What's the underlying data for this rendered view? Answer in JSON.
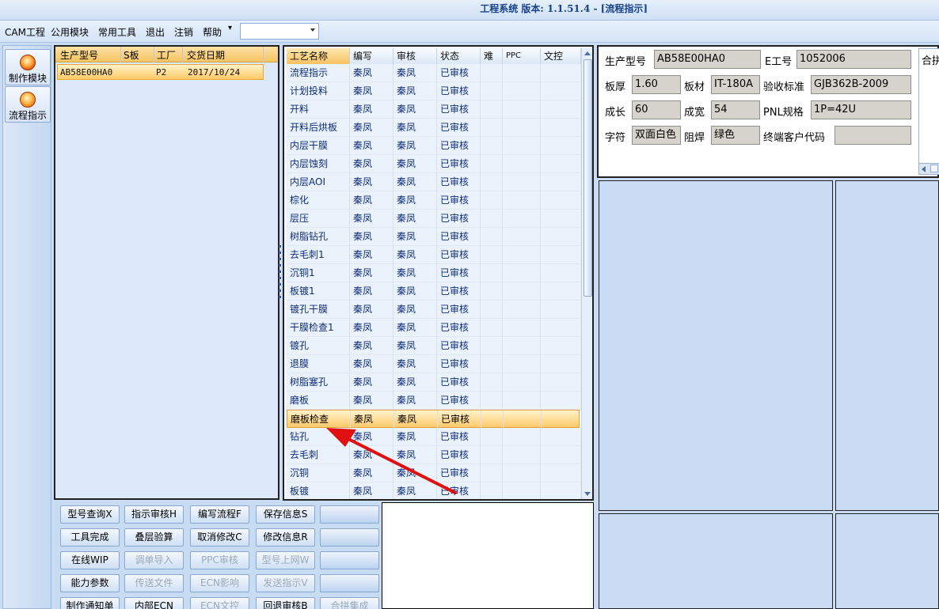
{
  "window": {
    "title": "工程系统  版本: 1.1.51.4 - [流程指示]"
  },
  "menu": {
    "items": [
      "CAM工程",
      "公用模块",
      "常用工具",
      "退出",
      "注销",
      "帮助"
    ],
    "combo_value": ""
  },
  "nav": {
    "make_module": "制作模块",
    "flow_guide": "流程指示"
  },
  "prod_table": {
    "headers": [
      "生产型号",
      "S板",
      "工厂",
      "交货日期"
    ],
    "row": {
      "model": "AB58E00HA0",
      "s_board": "",
      "factory": "P2",
      "date": "2017/10/24"
    }
  },
  "proc_table": {
    "headers": [
      "工艺名称",
      "编写",
      "审核",
      "状态",
      "难",
      "PPC",
      "文控"
    ],
    "rows": [
      {
        "name": "流程指示",
        "writer": "秦凤",
        "reviewer": "秦凤",
        "status": "已审核"
      },
      {
        "name": "计划投料",
        "writer": "秦凤",
        "reviewer": "秦凤",
        "status": "已审核"
      },
      {
        "name": "开料",
        "writer": "秦凤",
        "reviewer": "秦凤",
        "status": "已审核"
      },
      {
        "name": "开料后烘板",
        "writer": "秦凤",
        "reviewer": "秦凤",
        "status": "已审核"
      },
      {
        "name": "内层干膜",
        "writer": "秦凤",
        "reviewer": "秦凤",
        "status": "已审核"
      },
      {
        "name": "内层蚀刻",
        "writer": "秦凤",
        "reviewer": "秦凤",
        "status": "已审核"
      },
      {
        "name": "内层AOI",
        "writer": "秦凤",
        "reviewer": "秦凤",
        "status": "已审核"
      },
      {
        "name": "棕化",
        "writer": "秦凤",
        "reviewer": "秦凤",
        "status": "已审核"
      },
      {
        "name": "层压",
        "writer": "秦凤",
        "reviewer": "秦凤",
        "status": "已审核"
      },
      {
        "name": "树脂钻孔",
        "writer": "秦凤",
        "reviewer": "秦凤",
        "status": "已审核"
      },
      {
        "name": "去毛刺1",
        "writer": "秦凤",
        "reviewer": "秦凤",
        "status": "已审核"
      },
      {
        "name": "沉铜1",
        "writer": "秦凤",
        "reviewer": "秦凤",
        "status": "已审核"
      },
      {
        "name": "板镀1",
        "writer": "秦凤",
        "reviewer": "秦凤",
        "status": "已审核"
      },
      {
        "name": "镀孔干膜",
        "writer": "秦凤",
        "reviewer": "秦凤",
        "status": "已审核"
      },
      {
        "name": "干膜检查1",
        "writer": "秦凤",
        "reviewer": "秦凤",
        "status": "已审核"
      },
      {
        "name": "镀孔",
        "writer": "秦凤",
        "reviewer": "秦凤",
        "status": "已审核"
      },
      {
        "name": "退膜",
        "writer": "秦凤",
        "reviewer": "秦凤",
        "status": "已审核"
      },
      {
        "name": "树脂塞孔",
        "writer": "秦凤",
        "reviewer": "秦凤",
        "status": "已审核"
      },
      {
        "name": "磨板",
        "writer": "秦凤",
        "reviewer": "秦凤",
        "status": "已审核"
      },
      {
        "name": "磨板检查",
        "writer": "秦凤",
        "reviewer": "秦凤",
        "status": "已审核",
        "selected": true
      },
      {
        "name": "钻孔",
        "writer": "秦凤",
        "reviewer": "秦凤",
        "status": "已审核"
      },
      {
        "name": "去毛刺",
        "writer": "秦凤",
        "reviewer": "秦凤",
        "status": "已审核"
      },
      {
        "name": "沉铜",
        "writer": "秦凤",
        "reviewer": "秦凤",
        "status": "已审核"
      },
      {
        "name": "板镀",
        "writer": "秦凤",
        "reviewer": "秦凤",
        "status": "已审核"
      }
    ]
  },
  "buttons": [
    {
      "label": "型号查询X",
      "enabled": true
    },
    {
      "label": "指示审核H",
      "enabled": true
    },
    {
      "label": "编写流程F",
      "enabled": true
    },
    {
      "label": "保存信息S",
      "enabled": true
    },
    {
      "label": "",
      "enabled": true
    },
    {
      "label": "工具完成",
      "enabled": true
    },
    {
      "label": "叠层验算",
      "enabled": true
    },
    {
      "label": "取消修改C",
      "enabled": true
    },
    {
      "label": "修改信息R",
      "enabled": true
    },
    {
      "label": "",
      "enabled": true
    },
    {
      "label": "在线WIP",
      "enabled": true
    },
    {
      "label": "调单导入",
      "enabled": false
    },
    {
      "label": "PPC审核",
      "enabled": false
    },
    {
      "label": "型号上网W",
      "enabled": false
    },
    {
      "label": "",
      "enabled": true
    },
    {
      "label": "能力参数",
      "enabled": true
    },
    {
      "label": "传送文件",
      "enabled": false
    },
    {
      "label": "ECN影响",
      "enabled": false
    },
    {
      "label": "发送指示V",
      "enabled": false
    },
    {
      "label": "",
      "enabled": true
    },
    {
      "label": "制作通知单",
      "enabled": true
    },
    {
      "label": "内部ECN",
      "enabled": true
    },
    {
      "label": "ECN文控",
      "enabled": false
    },
    {
      "label": "回退审核B",
      "enabled": true
    },
    {
      "label": "合拼集成",
      "enabled": false
    }
  ],
  "info": {
    "prod_model_label": "生产型号",
    "prod_model": "AB58E00HA0",
    "e_job_label": "E工号",
    "e_job": "1052006",
    "thickness_label": "板厚",
    "thickness": "1.60",
    "material_label": "板材",
    "material": "IT-180A",
    "standard_label": "验收标准",
    "standard": "GJB362B-2009",
    "length_label": "成长",
    "length": "60",
    "width_label": "成宽",
    "width": "54",
    "pnl_label": "PNL规格",
    "pnl": "1P=42U",
    "char_label": "字符",
    "char": "双面白色",
    "mask_label": "阻焊",
    "mask": "绿色",
    "customer_label": "终端客户代码",
    "customer": "",
    "merge_label": "合拼"
  },
  "colors": {
    "arrow": "#e01010",
    "selected_row": "#ffca6c",
    "text_blue": "#0f2d7a"
  }
}
